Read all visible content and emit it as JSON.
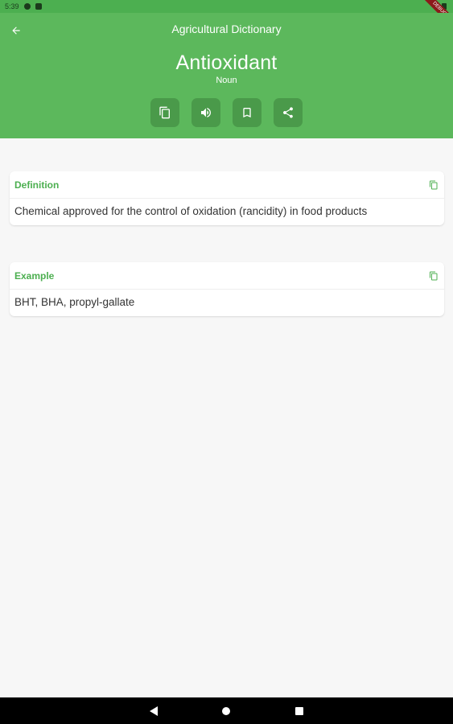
{
  "status_bar": {
    "time": "5:39"
  },
  "debug_banner": "DEBUG",
  "header": {
    "title": "Agricultural Dictionary",
    "word": "Antioxidant",
    "part_of_speech": "Noun",
    "actions": [
      "copy-icon",
      "volume-icon",
      "bookmark-icon",
      "share-icon"
    ]
  },
  "definition": {
    "label": "Definition",
    "text": "Chemical approved for the control of oxidation (rancidity) in food products"
  },
  "example": {
    "label": "Example",
    "text": "BHT, BHA, propyl-gallate"
  },
  "colors": {
    "header": "#5cb85c",
    "accent": "#4caf50",
    "background": "#f7f7f7"
  }
}
